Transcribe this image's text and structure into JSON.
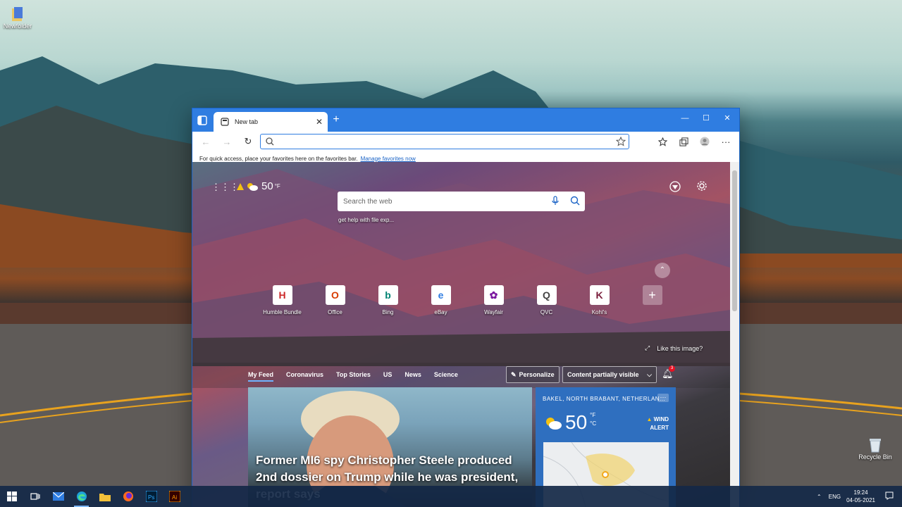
{
  "desktop": {
    "icons": [
      {
        "label": "Newfolder"
      },
      {
        "label": "Recycle Bin"
      }
    ]
  },
  "browser": {
    "tab": {
      "title": "New tab",
      "close_glyph": "✕"
    },
    "new_tab_glyph": "+",
    "window_controls": {
      "minimize": "—",
      "maximize": "☐",
      "close": "✕"
    },
    "toolbar": {
      "back": "←",
      "forward": "→",
      "refresh": "↻",
      "address_value": "",
      "address_placeholder": "",
      "more": "···"
    },
    "favorites_bar": {
      "text": "For quick access, place your favorites here on the favorites bar.",
      "link": "Manage favorites now"
    }
  },
  "ntp": {
    "apps_glyph": "⋮⋮⋮",
    "weather_mini": {
      "temp": "50",
      "unit": "°F",
      "alert_icon": "warning-icon",
      "condition_icon": "partly-cloudy-icon"
    },
    "search": {
      "placeholder": "Search the web"
    },
    "suggestion": "get help with file exp...",
    "collapse_glyph": "⌃",
    "quick_links": [
      {
        "label": "Humble Bundle",
        "glyph": "H",
        "color": "#cc2929"
      },
      {
        "label": "Office",
        "glyph": "O",
        "color": "#d83b01"
      },
      {
        "label": "Bing",
        "glyph": "b",
        "color": "#008373"
      },
      {
        "label": "eBay",
        "glyph": "e",
        "color": "#2f7de1"
      },
      {
        "label": "Wayfair",
        "glyph": "✿",
        "color": "#7b189f"
      },
      {
        "label": "QVC",
        "glyph": "Q",
        "color": "#444444"
      },
      {
        "label": "Kohl's",
        "glyph": "K",
        "color": "#7a1e3c"
      }
    ],
    "add_tile_glyph": "+",
    "like_image": "Like this image?",
    "feed": {
      "tabs": [
        "My Feed",
        "Coronavirus",
        "Top Stories",
        "US",
        "News",
        "Science"
      ],
      "active_tab": "My Feed",
      "personalize": "Personalize",
      "visibility": "Content partially visible",
      "notification_count": "3"
    },
    "news_card": {
      "headline": "Former MI6 spy Christopher Steele produced 2nd dossier on Trump while he was president, report says"
    },
    "weather_card": {
      "location": "BAKEL, NORTH BRABANT, NETHERLAN...",
      "temp": "50",
      "unit_f": "°F",
      "unit_c": "°C",
      "alert_line1": "WIND",
      "alert_line2": "ALERT",
      "more": "···"
    }
  },
  "taskbar": {
    "language": "ENG",
    "time": "19:24",
    "date": "04-05-2021"
  },
  "colors": {
    "edge_blue": "#2f7de1",
    "weather_card": "#2f6fbf",
    "taskbar": "#142846"
  }
}
